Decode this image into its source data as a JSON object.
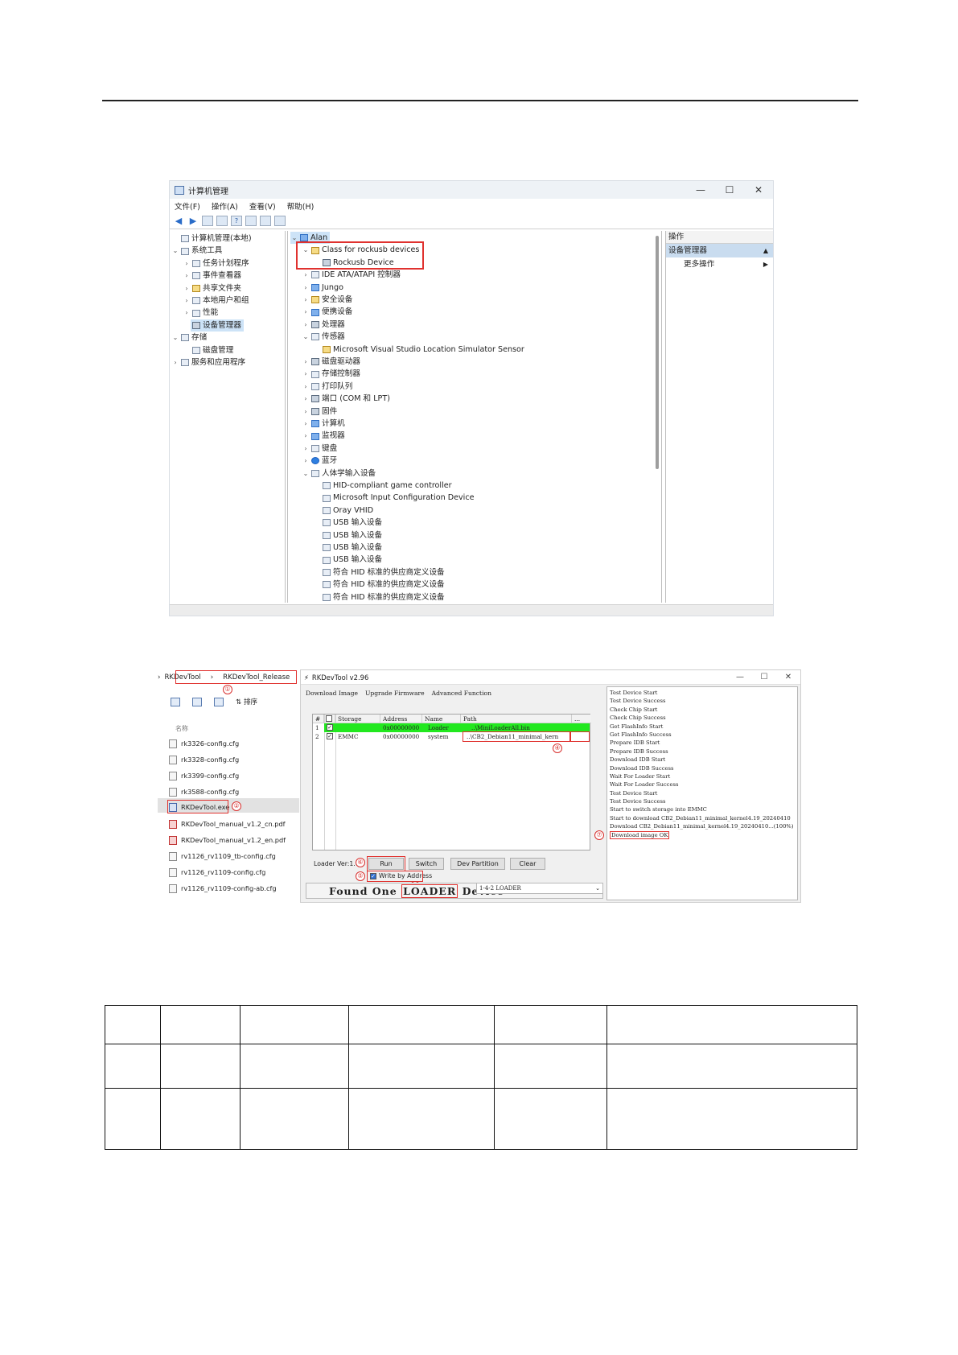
{
  "computer_management": {
    "title": "计算机管理",
    "window_controls": [
      "—",
      "☐",
      "✕"
    ],
    "menu": [
      "文件(F)",
      "操作(A)",
      "查看(V)",
      "帮助(H)"
    ],
    "left_tree": [
      {
        "label": "计算机管理(本地)",
        "expander": ""
      },
      {
        "label": "系统工具",
        "expander": "⌄"
      },
      {
        "label": "任务计划程序",
        "expander": "›"
      },
      {
        "label": "事件查看器",
        "expander": "›"
      },
      {
        "label": "共享文件夹",
        "expander": "›"
      },
      {
        "label": "本地用户和组",
        "expander": "›"
      },
      {
        "label": "性能",
        "expander": "›"
      },
      {
        "label": "设备管理器",
        "expander": ""
      },
      {
        "label": "存储",
        "expander": "⌄"
      },
      {
        "label": "磁盘管理",
        "expander": ""
      },
      {
        "label": "服务和应用程序",
        "expander": "›"
      }
    ],
    "device_tree": [
      {
        "label": "Alan",
        "expander": "⌄"
      },
      {
        "label": "Class for rockusb devices",
        "expander": "⌄"
      },
      {
        "label": "Rockusb Device",
        "expander": ""
      },
      {
        "label": "IDE ATA/ATAPI 控制器",
        "expander": "›"
      },
      {
        "label": "Jungo",
        "expander": "›"
      },
      {
        "label": "安全设备",
        "expander": "›"
      },
      {
        "label": "便携设备",
        "expander": "›"
      },
      {
        "label": "处理器",
        "expander": "›"
      },
      {
        "label": "传感器",
        "expander": "⌄"
      },
      {
        "label": "Microsoft Visual Studio Location Simulator Sensor",
        "expander": ""
      },
      {
        "label": "磁盘驱动器",
        "expander": "›"
      },
      {
        "label": "存储控制器",
        "expander": "›"
      },
      {
        "label": "打印队列",
        "expander": "›"
      },
      {
        "label": "端口 (COM 和 LPT)",
        "expander": "›"
      },
      {
        "label": "固件",
        "expander": "›"
      },
      {
        "label": "计算机",
        "expander": "›"
      },
      {
        "label": "监视器",
        "expander": "›"
      },
      {
        "label": "键盘",
        "expander": "›"
      },
      {
        "label": "蓝牙",
        "expander": "›"
      },
      {
        "label": "人体学输入设备",
        "expander": "⌄"
      },
      {
        "label": "HID-compliant game controller",
        "expander": ""
      },
      {
        "label": "Microsoft Input Configuration Device",
        "expander": ""
      },
      {
        "label": "Oray VHID",
        "expander": ""
      },
      {
        "label": "USB 输入设备",
        "expander": ""
      },
      {
        "label": "USB 输入设备",
        "expander": ""
      },
      {
        "label": "USB 输入设备",
        "expander": ""
      },
      {
        "label": "USB 输入设备",
        "expander": ""
      },
      {
        "label": "符合 HID 标准的供应商定义设备",
        "expander": ""
      },
      {
        "label": "符合 HID 标准的供应商定义设备",
        "expander": ""
      },
      {
        "label": "符合 HID 标准的供应商定义设备",
        "expander": ""
      }
    ],
    "actions": {
      "header": "操作",
      "section": "设备管理器",
      "more": "更多操作"
    }
  },
  "explorer": {
    "breadcrumb": [
      "RKDevTool",
      "RKDevTool_Release"
    ],
    "sort_label": "排序",
    "column_name": "名称",
    "files": [
      "rk3326-config.cfg",
      "rk3328-config.cfg",
      "rk3399-config.cfg",
      "rk3588-config.cfg",
      "RKDevTool.exe",
      "RKDevTool_manual_v1.2_cn.pdf",
      "RKDevTool_manual_v1.2_en.pdf",
      "rv1126_rv1109_tb-config.cfg",
      "rv1126_rv1109-config.cfg",
      "rv1126_rv1109-config-ab.cfg"
    ]
  },
  "rkdevtool": {
    "title": "RKDevTool v2.96",
    "window_controls": [
      "—",
      "☐",
      "✕"
    ],
    "tabs": [
      "Download Image",
      "Upgrade Firmware",
      "Advanced Function"
    ],
    "grid_headers": [
      "#",
      "",
      "Storage",
      "Address",
      "Name",
      "Path",
      "..."
    ],
    "rows": [
      {
        "index": "1",
        "checked": "✓",
        "storage": "",
        "address": "0x00000000",
        "name": "Loader",
        "path": "..\\MiniLoaderAll.bin"
      },
      {
        "index": "2",
        "checked": "✓",
        "storage": "EMMC",
        "address": "0x00000000",
        "name": "system",
        "path": "..\\CB2_Debian11_minimal_kern"
      }
    ],
    "loader_version": "Loader Ver:1.01",
    "buttons": {
      "run": "Run",
      "switch": "Switch",
      "dev_partition": "Dev Partition",
      "clear": "Clear"
    },
    "write_by_address": "Write by Address",
    "status": {
      "prefix": "Found One",
      "highlight": "LOADER",
      "suffix": "Device"
    },
    "combo": "1-4-2  LOADER",
    "log": [
      "Test Device Start",
      "Test Device Success",
      "Check Chip Start",
      "Check Chip Success",
      "Get FlashInfo Start",
      "Get FlashInfo Success",
      "Prepare IDB Start",
      "Prepare IDB Success",
      "Download IDB Start",
      "Download IDB Success",
      "Wait For Loader Start",
      "Wait For Loader Success",
      "Test Device Start",
      "Test Device Success",
      "Start to switch storage into EMMC",
      "Start to download CB2_Debian11_minimal_kernel4.19_20240410",
      "Download CB2_Debian11_minimal_kernel4.19_20240410...(100%)",
      "Download image OK"
    ],
    "step_markers": [
      "①",
      "②",
      "③",
      "④",
      "⑤",
      "⑥",
      "⑦"
    ]
  }
}
